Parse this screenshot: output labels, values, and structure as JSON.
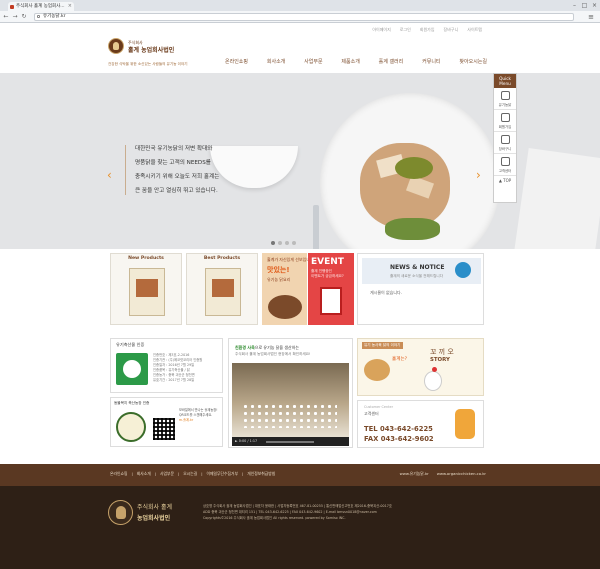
{
  "browser": {
    "tab_title": "주식회사 홀계 농업회사...",
    "address": "유기농닭.kr"
  },
  "top_nav": [
    "아이페이지",
    "로그인",
    "회원가입",
    "장바구니",
    "사이트맵"
  ],
  "logo": {
    "sub": "주식회사",
    "main": "홀계 농업회사법인",
    "slogan": "건강한 식탁을 위한 소신있는 사람들의 유기농 이야기"
  },
  "main_nav": [
    "온라인쇼핑",
    "회사소개",
    "사업부문",
    "제품소개",
    "홀계 갤러리",
    "커뮤니티",
    "찾아오시는길"
  ],
  "hero": {
    "lines": [
      "대한민국 유기농닭의 저변 확대와",
      "명품닭을 찾는 고객의 NEEDS를",
      "충족시키기 위해 오늘도 저희 홀계는",
      "큰 꿈을 안고 열심히 뛰고 있습니다."
    ],
    "prev": "‹",
    "next": "›"
  },
  "quick_menu": {
    "title": "Quick Menu",
    "items": [
      "유기농닭",
      "회원가입",
      "장바구니",
      "고객센터"
    ],
    "top": "▲ TOP"
  },
  "cards": {
    "new_products": "New Products",
    "best_products": "Best Products"
  },
  "promo": {
    "line1": "홀계가 자신있게 선보입니다",
    "big": "맛있는!",
    "line2": "유기농 닭요리"
  },
  "event": {
    "title": "EVENT",
    "sub1": "홀계 진행중인",
    "sub2": "이벤트가 궁금하세요?"
  },
  "news": {
    "title": "NEWS & NOTICE",
    "sub": "홀계의 새로운 소식을 전해드립니다",
    "empty": "게시물이 없습니다."
  },
  "cert": {
    "title": "유기축산물 인증",
    "info": [
      "인증번호 : 제3호-2-2016",
      "인증기관 : (주)에코넷코리아 인증원",
      "인증일자 : 2016년 7월 29일",
      "인증품목 : 유기축산물 / 닭",
      "인증농가 : 충북 괴산군 청천면",
      "유효기간 : 2017년 7월 28일"
    ],
    "haccp_title": "동물복지 축산농장 인증",
    "note1": "모바일에서 만나는 홀계농장!",
    "note2": "QR코드를 스캔해주세요.",
    "mobile_link": "m.홀계.kr"
  },
  "video": {
    "cap_pre": "친환경 사육",
    "cap_post": "으로 유기농 닭을 생산하는",
    "cap2": "주식회사 홀계 농업회사법인 현장에서 확인하세요!",
    "time": "0:00 / 1:17"
  },
  "story": {
    "tag": "유기 농사육 닭의 이야기",
    "name": "꼬 끼 오",
    "en": "STORY",
    "title": "홀계는?"
  },
  "cs": {
    "sub": "Customer Center",
    "title": "고객센터",
    "tel": "TEL 043-642-6225",
    "fax": "FAX 043-642-9602"
  },
  "footer": {
    "links": [
      "온라인쇼핑",
      "회사소개",
      "사업부문",
      "오시는길",
      "이메일무단수집거부",
      "개인정보취급방침"
    ],
    "sites": [
      "www.유기농닭.kr",
      "www.organicchicken.co.kr"
    ],
    "brand": "주식회사 홀계",
    "brand2": "농업회사법인",
    "info": [
      "상호명 주식회사 홀계 농업회사법인 | 대표자 윤태한 | 사업자등록번호 467-81-00255 | 통신판매업신고번호 제2016-충북괴산-0017호",
      "ADD 충북 괴산군 청천면 대티리 151 | TEL 043-642-6225 | FAX 043-642-9602 | E-mail bmssn0018@naver.com",
      "Copyrights©2016 주식회사 홀계 농업회사법인 All rights reserved. powered by Somiso INC."
    ]
  }
}
